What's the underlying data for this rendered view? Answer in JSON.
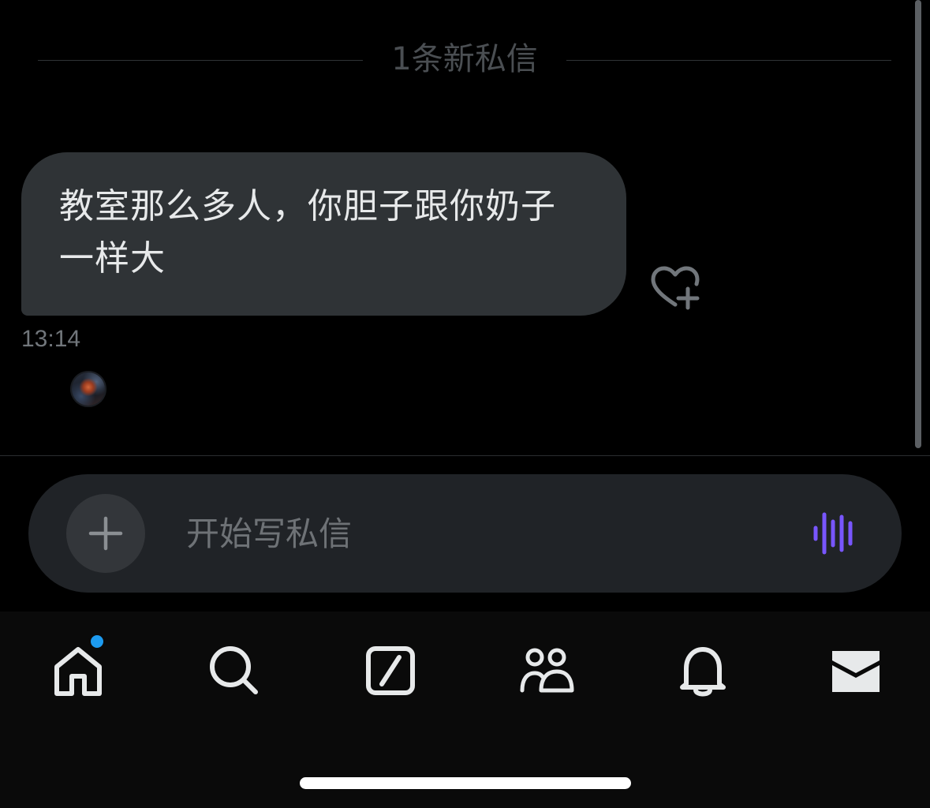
{
  "chat": {
    "new_divider_text": "1条新私信",
    "messages": [
      {
        "line1": "教室那么多人，你胆子跟你奶子",
        "line2": "一样大",
        "time": "13:14"
      }
    ]
  },
  "icons": {
    "reaction": "heart-plus-icon",
    "add": "plus-icon",
    "voice": "voice-waveform-icon"
  },
  "composer": {
    "placeholder": "开始写私信"
  },
  "tabbar": {
    "tabs": [
      {
        "name": "home",
        "icon": "home-icon",
        "has_badge": true
      },
      {
        "name": "search",
        "icon": "search-icon",
        "has_badge": false
      },
      {
        "name": "compose",
        "icon": "compose-icon",
        "has_badge": false
      },
      {
        "name": "communities",
        "icon": "people-icon",
        "has_badge": false
      },
      {
        "name": "notifications",
        "icon": "bell-icon",
        "has_badge": false
      },
      {
        "name": "messages",
        "icon": "envelope-icon",
        "has_badge": false
      }
    ]
  },
  "colors": {
    "background": "#000000",
    "bubble": "#2f3336",
    "composer": "#202327",
    "accent_badge": "#1d9bf0",
    "voice_accent": "#7856ff"
  }
}
